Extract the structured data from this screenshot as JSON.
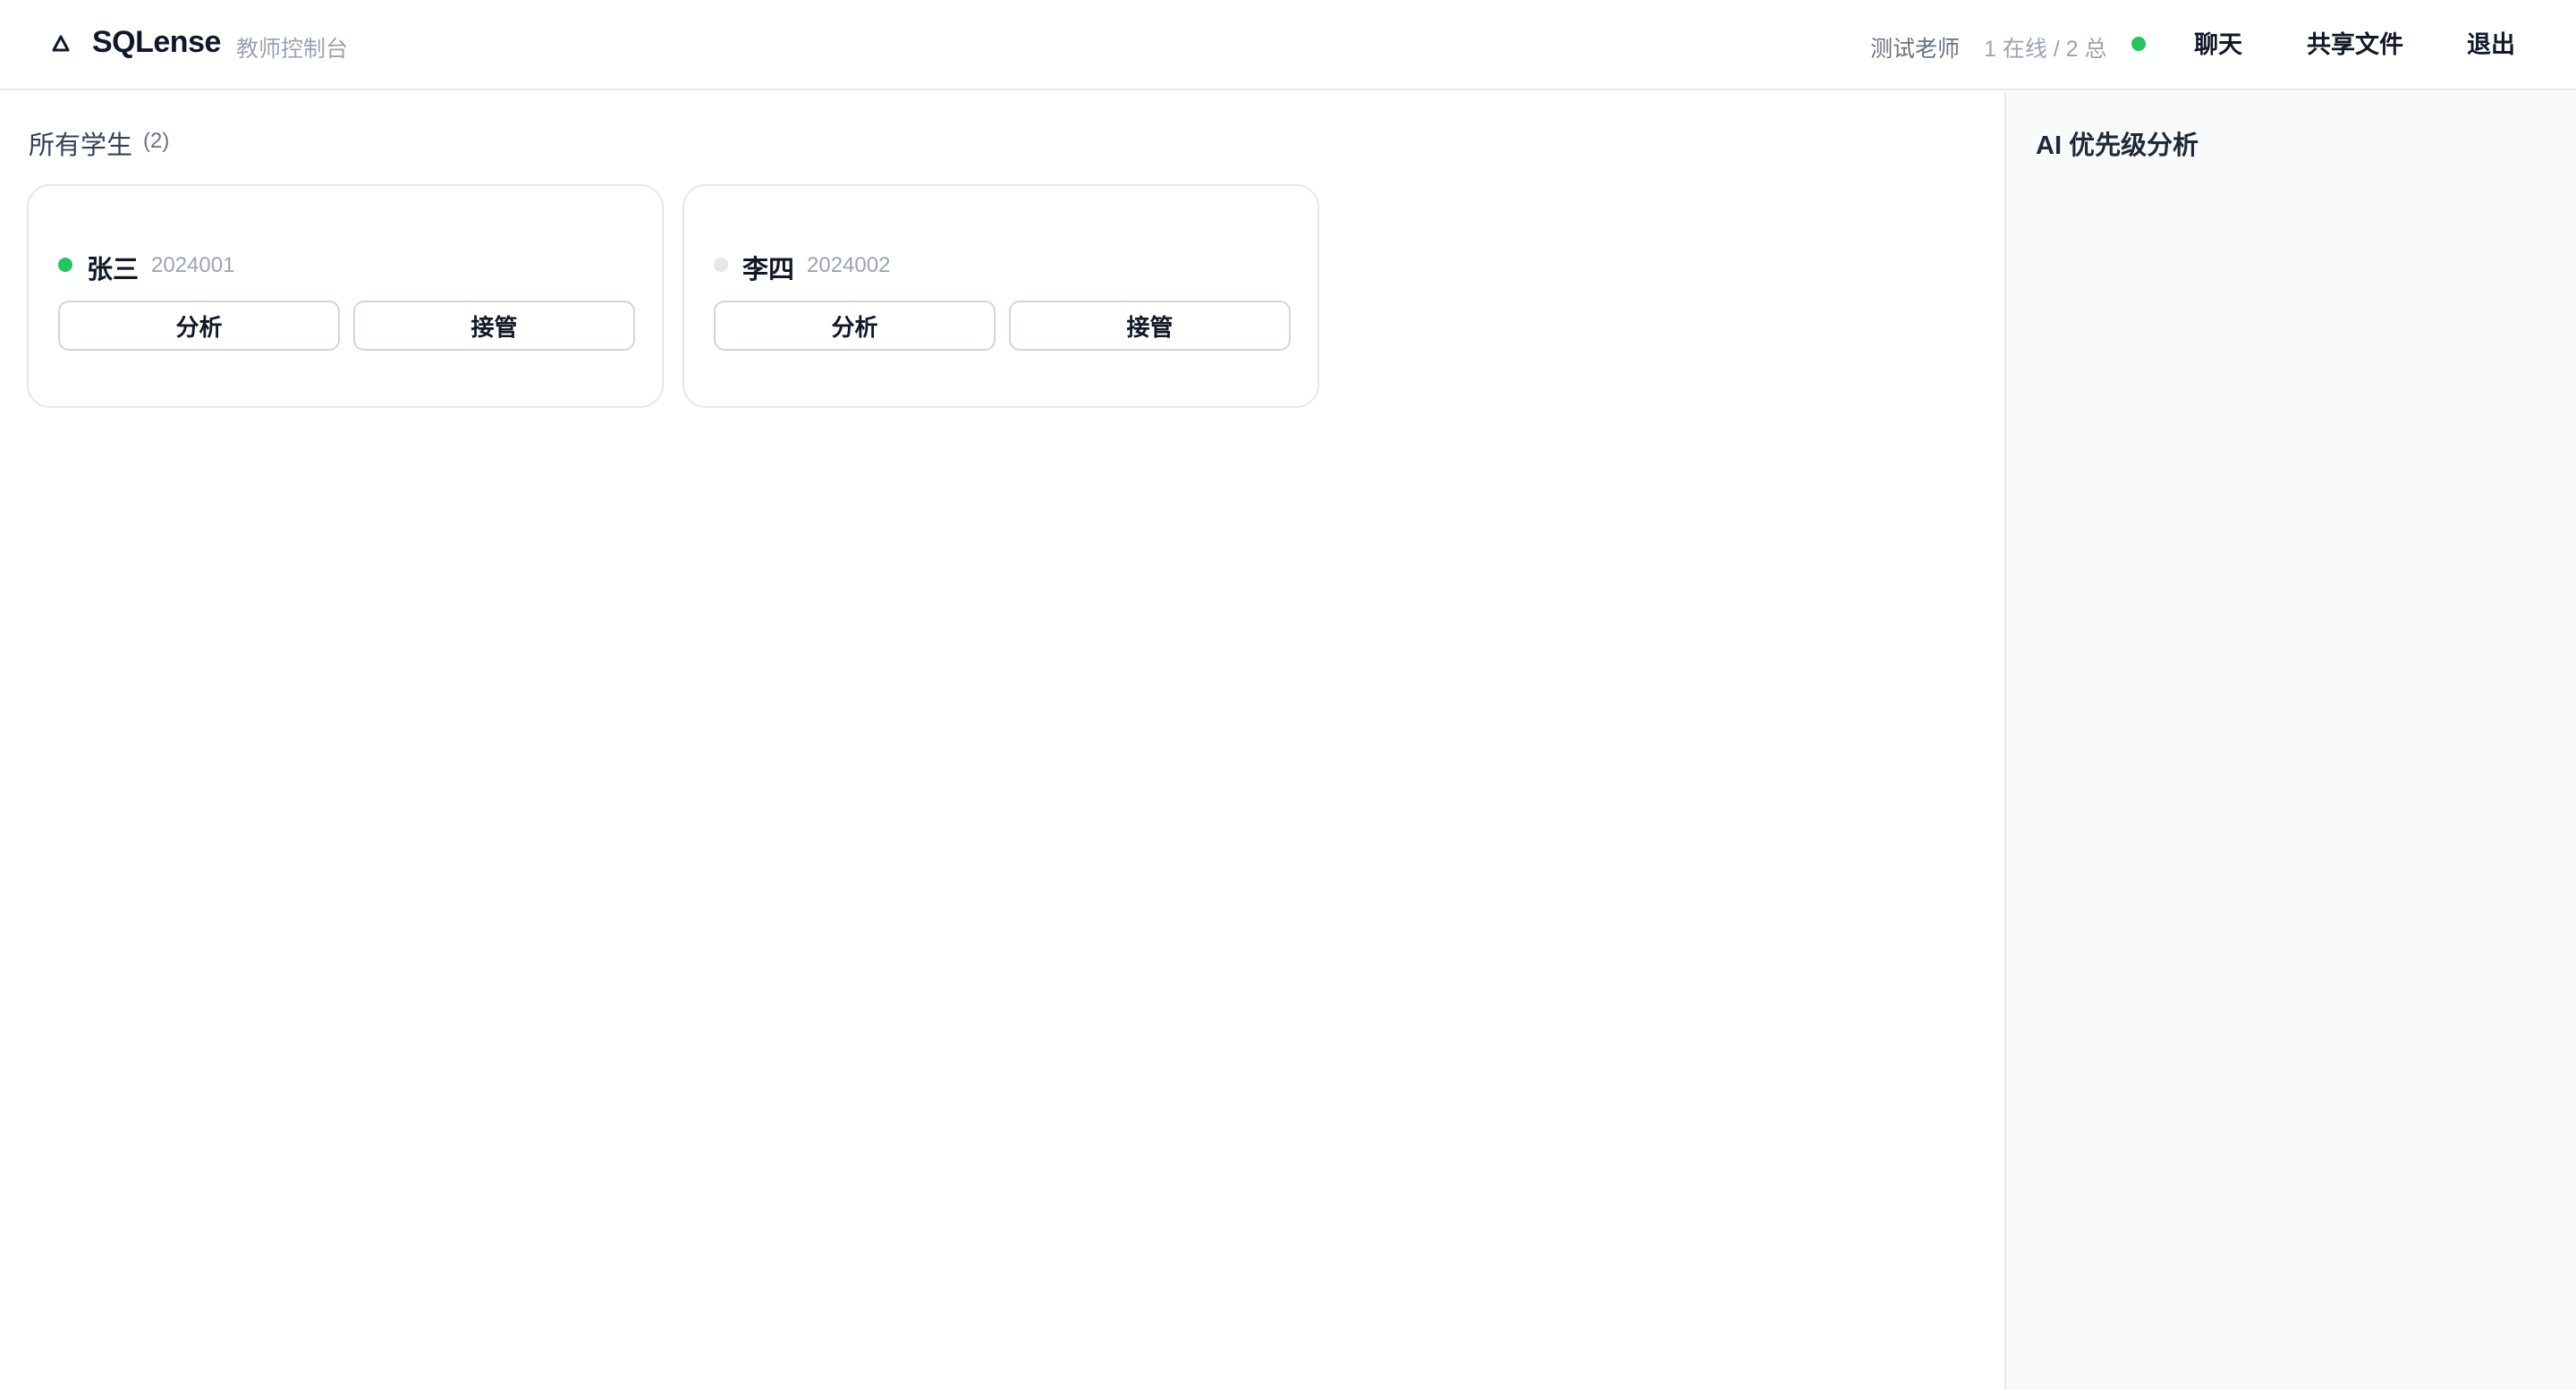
{
  "header": {
    "brand": "SQLense",
    "subtitle": "教师控制台",
    "teacher_name": "测试老师",
    "online_summary": "1 在线 / 2 总",
    "status_color": "#22c55e",
    "logo_icon": "triangle-logo-icon",
    "nav": {
      "chat": "聊天",
      "shared_files": "共享文件",
      "logout": "退出"
    }
  },
  "main": {
    "section_title": "所有学生",
    "section_count": "(2)",
    "students": [
      {
        "name": "张三",
        "id": "2024001",
        "status": "online",
        "status_color": "#22c55e",
        "analyze_label": "分析",
        "takeover_label": "接管"
      },
      {
        "name": "李四",
        "id": "2024002",
        "status": "offline",
        "status_color": "#e5e7eb",
        "analyze_label": "分析",
        "takeover_label": "接管"
      }
    ]
  },
  "aside": {
    "title": "AI 优先级分析"
  }
}
